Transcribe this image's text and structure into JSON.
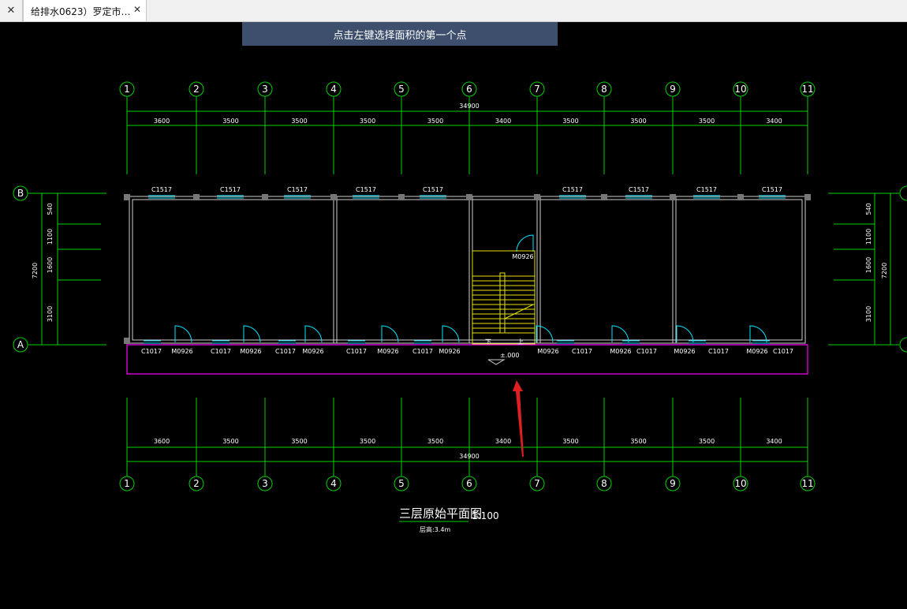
{
  "tabs": {
    "close_left": "✕",
    "active_label": "给排水0623）罗定市…",
    "active_close": "✕"
  },
  "prompt": "点击左键选择面积的第一个点",
  "grid": {
    "columns": [
      "1",
      "2",
      "3",
      "4",
      "5",
      "6",
      "7",
      "8",
      "9",
      "10",
      "11"
    ],
    "rows": [
      "B",
      "A"
    ],
    "spans": [
      "3600",
      "3500",
      "3500",
      "3500",
      "3500",
      "3400",
      "3500",
      "3500",
      "3500",
      "3400"
    ],
    "total": "34900",
    "side_dims": [
      "540",
      "1100",
      "1600",
      "3100"
    ],
    "side_total": "7200"
  },
  "labels": {
    "top_windows": [
      "C1517",
      "C1517",
      "C1517",
      "C1517",
      "C1517",
      "C1517",
      "C1517",
      "C1517",
      "C1517"
    ],
    "bottom": [
      "C1017",
      "M0926",
      "C1017",
      "M0926",
      "C1017",
      "M0926",
      "C1017",
      "M0926",
      "C1017",
      "M0926",
      "M0926",
      "C1017",
      "M0926",
      "C1017",
      "M0926",
      "C1017",
      "M0926",
      "C1017"
    ],
    "stair_door": "M0926",
    "elevation": "±.000",
    "stair_down": "下",
    "stair_up": "上"
  },
  "title": {
    "main": "三层原始平面图",
    "scale": "1:100",
    "sub": "层高:3.4m"
  },
  "colors": {
    "grid": "#00d000",
    "wall": "#cfcfcf",
    "window": "#00e5ff",
    "stair": "#e8e000",
    "area": "#ff00ff",
    "arrow": "#e02020",
    "prompt_bg": "#3e4f6e"
  }
}
